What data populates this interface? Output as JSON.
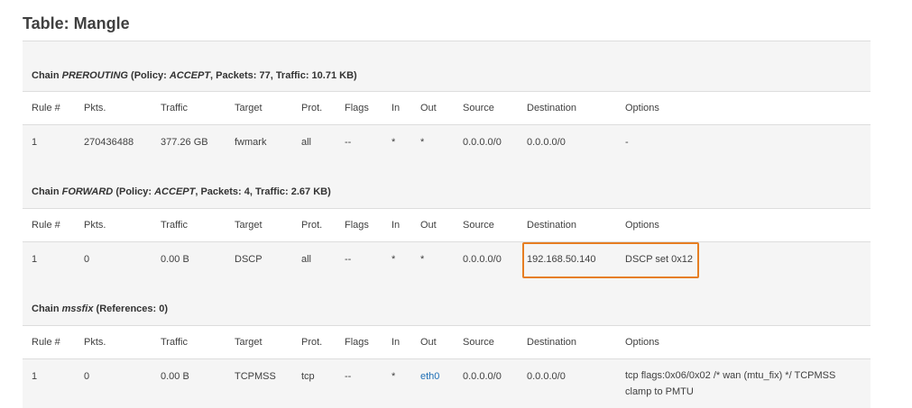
{
  "page": {
    "title": "Table: Mangle"
  },
  "columns": [
    "Rule #",
    "Pkts.",
    "Traffic",
    "Target",
    "Prot.",
    "Flags",
    "In",
    "Out",
    "Source",
    "Destination",
    "Options"
  ],
  "chains": [
    {
      "label_prefix": "Chain ",
      "name": "PREROUTING",
      "info_open": " (Policy: ",
      "policy": "ACCEPT",
      "info_rest": ", Packets: 77, Traffic: 10.71 KB)",
      "rows": [
        {
          "rule": "1",
          "pkts": "270436488",
          "traffic": "377.26 GB",
          "target": "fwmark",
          "prot": "all",
          "flags": "--",
          "in": "*",
          "out": "*",
          "source": "0.0.0.0/0",
          "destination": "0.0.0.0/0",
          "options": "-"
        }
      ]
    },
    {
      "label_prefix": "Chain ",
      "name": "FORWARD",
      "info_open": " (Policy: ",
      "policy": "ACCEPT",
      "info_rest": ", Packets: 4, Traffic: 2.67 KB)",
      "rows": [
        {
          "rule": "1",
          "pkts": "0",
          "traffic": "0.00 B",
          "target": "DSCP",
          "prot": "all",
          "flags": "--",
          "in": "*",
          "out": "*",
          "source": "0.0.0.0/0",
          "destination": "192.168.50.140",
          "options": "DSCP set 0x12"
        }
      ]
    },
    {
      "label_prefix": "Chain ",
      "name": "mssfix",
      "info_open": " (References: 0)",
      "policy": "",
      "info_rest": "",
      "rows": [
        {
          "rule": "1",
          "pkts": "0",
          "traffic": "0.00 B",
          "target": "TCPMSS",
          "prot": "tcp",
          "flags": "--",
          "in": "*",
          "out": "eth0",
          "source": "0.0.0.0/0",
          "destination": "0.0.0.0/0",
          "options": "tcp flags:0x06/0x02 /* wan (mtu_fix) */ TCPMSS clamp to PMTU"
        }
      ]
    }
  ],
  "highlight": {
    "color": "#e67e22",
    "cells": [
      "FORWARD.destination",
      "FORWARD.options"
    ]
  },
  "colors": {
    "header_bg": "#f5f5f5",
    "link": "#1f6fb5"
  }
}
